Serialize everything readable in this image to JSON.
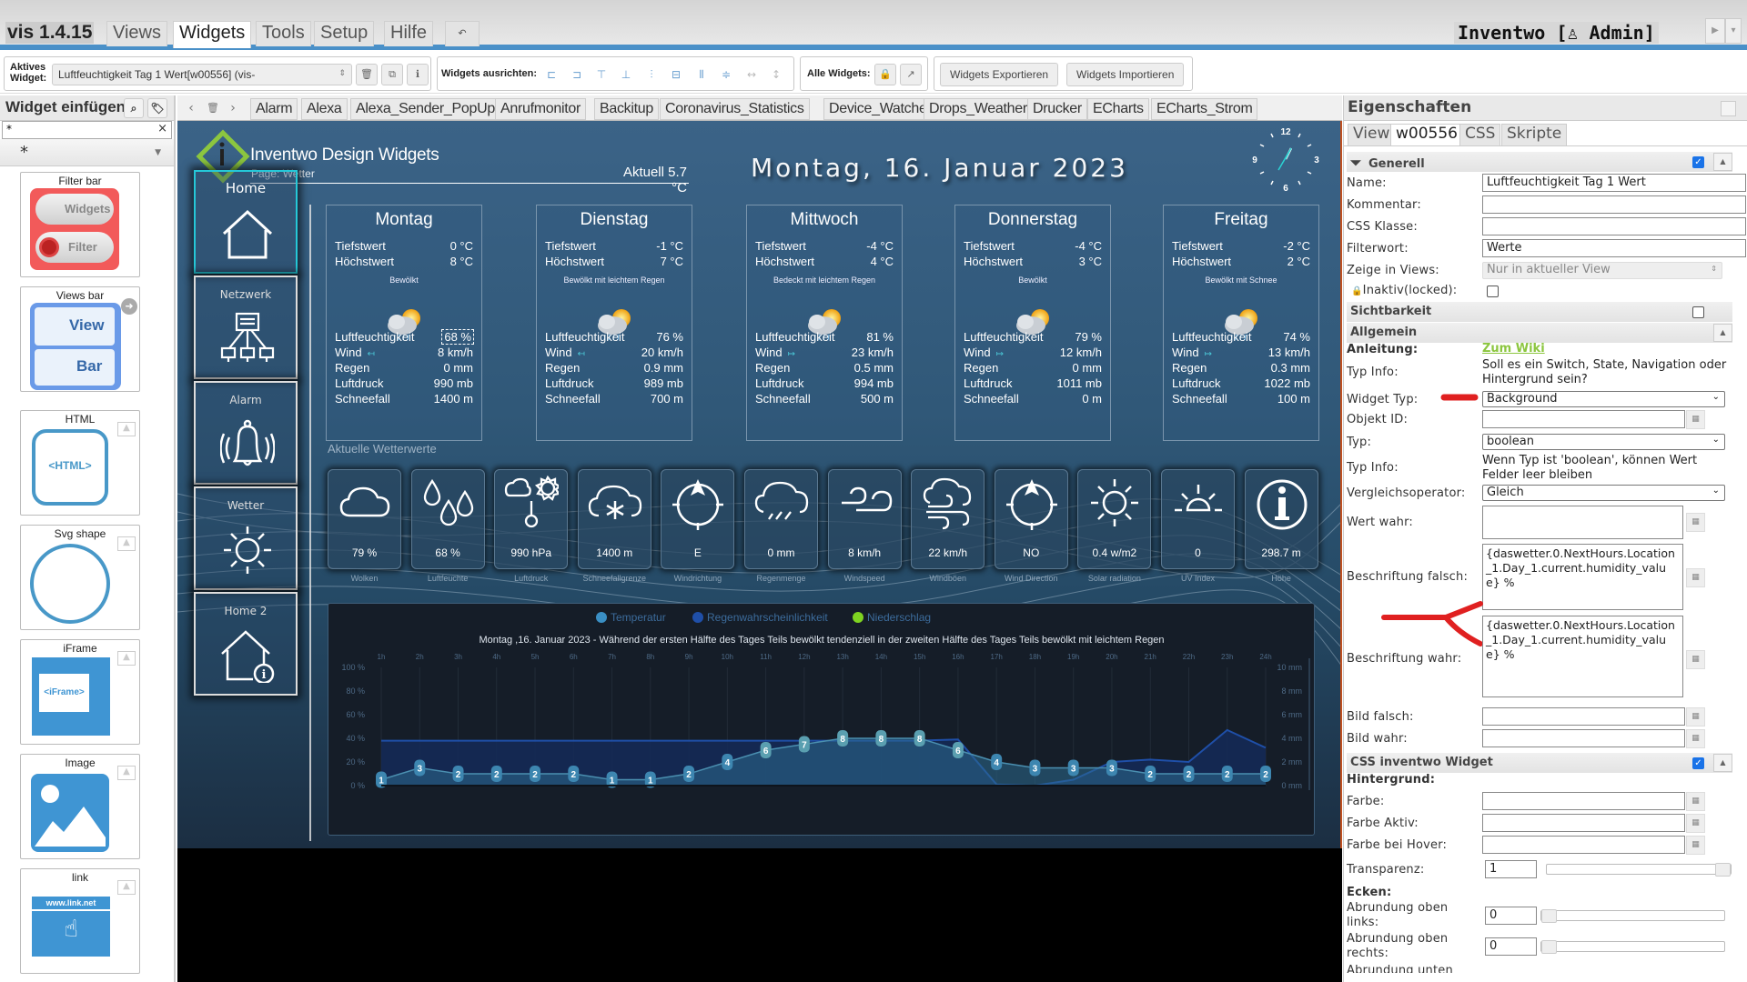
{
  "topbar": {
    "app_version": "vis 1.4.15",
    "menu": [
      "Views",
      "Widgets",
      "Tools",
      "Setup",
      "Hilfe"
    ],
    "active_menu": "Widgets",
    "undo_icon": "undo-icon",
    "project_user": "Inventwo [♙ Admin]"
  },
  "toolbar": {
    "active_widget_label": "Aktives Widget:",
    "active_widget_value": "Luftfeuchtigkeit Tag 1 Wert[w00556] (vis-",
    "align_label": "Widgets ausrichten:",
    "all_widgets_label": "Alle Widgets:",
    "export_label": "Widgets Exportieren",
    "import_label": "Widgets Importieren"
  },
  "palette": {
    "title": "Widget einfügen",
    "search_value": "*",
    "filter_value": "*",
    "cards": [
      {
        "title": "Filter bar",
        "btn1": "Widgets",
        "btn2": "Filter"
      },
      {
        "title": "Views bar",
        "btn1": "View",
        "btn2": "Bar"
      },
      {
        "title": "HTML",
        "label": "<HTML>"
      },
      {
        "title": "Svg shape"
      },
      {
        "title": "iFrame",
        "label": "<iFrame>"
      },
      {
        "title": "Image"
      },
      {
        "title": "link",
        "label": "www.link.net"
      }
    ]
  },
  "view_tabs": [
    "Alarm",
    "Alexa",
    "Alexa_Sender_PopUp",
    "Anrufmonitor",
    "Backitup",
    "Coronavirus_Statistics",
    "Device_Watcher",
    "Drops_Weather",
    "Drucker",
    "ECharts",
    "ECharts_Strom"
  ],
  "dashboard": {
    "title": "Inventwo Design Widgets",
    "page": "Page: Wetter",
    "current_temp": "Aktuell 5.7 °C",
    "date": "Montag, 16. Januar 2023",
    "clock": {
      "n12": "12",
      "n3": "3",
      "n6": "6",
      "n9": "9"
    },
    "nav": [
      {
        "label": "Home",
        "icon": "home-icon",
        "active": true
      },
      {
        "label": "Netzwerk",
        "icon": "network-icon"
      },
      {
        "label": "Alarm",
        "icon": "bell-icon"
      },
      {
        "label": "Wetter",
        "icon": "sun-icon"
      },
      {
        "label": "Home 2",
        "icon": "home-info-icon"
      }
    ],
    "row_labels": {
      "low": "Tiefstwert",
      "high": "Höchstwert",
      "hum": "Luftfeuchtigkeit",
      "wind": "Wind",
      "rain": "Regen",
      "pressure": "Luftdruck",
      "snow": "Schneefall"
    },
    "days": [
      {
        "name": "Montag",
        "low": "0 °C",
        "high": "8 °C",
        "desc": "Bewölkt",
        "hum": "68 %",
        "wind": "8 km/h",
        "wind_dir": "west",
        "rain": "0 mm",
        "pressure": "990 mb",
        "snow": "1400 m"
      },
      {
        "name": "Dienstag",
        "low": "-1 °C",
        "high": "7 °C",
        "desc": "Bewölkt mit leichtem Regen",
        "hum": "76 %",
        "wind": "20 km/h",
        "wind_dir": "west",
        "rain": "0.9 mm",
        "pressure": "989 mb",
        "snow": "700 m"
      },
      {
        "name": "Mittwoch",
        "low": "-4 °C",
        "high": "4 °C",
        "desc": "Bedeckt mit leichtem Regen",
        "hum": "81 %",
        "wind": "23 km/h",
        "wind_dir": "east",
        "rain": "0.5 mm",
        "pressure": "994 mb",
        "snow": "500 m"
      },
      {
        "name": "Donnerstag",
        "low": "-4 °C",
        "high": "3 °C",
        "desc": "Bewölkt",
        "hum": "79 %",
        "wind": "12 km/h",
        "wind_dir": "east",
        "rain": "0 mm",
        "pressure": "1011 mb",
        "snow": "0 m"
      },
      {
        "name": "Freitag",
        "low": "-2 °C",
        "high": "2 °C",
        "desc": "Bewölkt mit Schnee",
        "hum": "74 %",
        "wind": "13 km/h",
        "wind_dir": "east",
        "rain": "0.3 mm",
        "pressure": "1022 mb",
        "snow": "100 m"
      }
    ],
    "current_label": "Aktuelle Wetterwerte",
    "current": [
      {
        "value": "79 %",
        "label": "Wolken",
        "icon": "cloud-icon"
      },
      {
        "value": "68 %",
        "label": "Luftfeuchte",
        "icon": "droplets-icon"
      },
      {
        "value": "990 hPa",
        "label": "Luftdruck",
        "icon": "barometer-icon"
      },
      {
        "value": "1400 m",
        "label": "Schneefallgrenze",
        "icon": "snow-cloud-icon"
      },
      {
        "value": "E",
        "label": "Windrichtung",
        "icon": "compass-icon"
      },
      {
        "value": "0 mm",
        "label": "Regenmenge",
        "icon": "rain-cloud-icon"
      },
      {
        "value": "8 km/h",
        "label": "Windspeed",
        "icon": "wind-icon"
      },
      {
        "value": "22 km/h",
        "label": "Windböen",
        "icon": "wind-cloud-icon"
      },
      {
        "value": "NO",
        "label": "Wind Direction",
        "icon": "compass-icon"
      },
      {
        "value": "0.4 w/m2",
        "label": "Solar radiation",
        "icon": "sun-icon"
      },
      {
        "value": "0",
        "label": "UV Index",
        "icon": "sunrise-icon"
      },
      {
        "value": "298.7 m",
        "label": "Höhe",
        "icon": "info-icon"
      }
    ]
  },
  "chart_data": {
    "type": "line",
    "title": "Montag ,16. Januar 2023 - Während der ersten Hälfte des Tages Teils bewölkt tendenziell in der zweiten Hälfte des Tages Teils bewölkt mit leichtem Regen",
    "legend": [
      {
        "name": "Temperatur",
        "color": "#3a8fc4"
      },
      {
        "name": "Regenwahrscheinlichkeit",
        "color": "#1f4fa8"
      },
      {
        "name": "Niederschlag",
        "color": "#7ed321"
      }
    ],
    "legend_position": "top-center",
    "categories": [
      "1h",
      "2h",
      "3h",
      "4h",
      "5h",
      "6h",
      "7h",
      "8h",
      "9h",
      "10h",
      "11h",
      "12h",
      "13h",
      "14h",
      "15h",
      "16h",
      "17h",
      "18h",
      "19h",
      "20h",
      "21h",
      "22h",
      "23h",
      "24h"
    ],
    "y_left": {
      "ticks": [
        "0 %",
        "20 %",
        "40 %",
        "60 %",
        "80 %",
        "100 %"
      ],
      "range": [
        0,
        100
      ]
    },
    "y_right": {
      "ticks": [
        "0 mm",
        "2 mm",
        "4 mm",
        "6 mm",
        "8 mm",
        "10 mm"
      ],
      "range": [
        0,
        10
      ]
    },
    "series": [
      {
        "name": "Temperatur",
        "values": [
          1,
          3,
          2,
          2,
          2,
          2,
          1,
          1,
          2,
          4,
          6,
          7,
          8,
          8,
          8,
          6,
          4,
          3,
          3,
          3,
          2,
          2,
          2,
          2
        ],
        "scale_max": 20
      },
      {
        "name": "Regenwahrscheinlichkeit",
        "values": [
          38,
          38,
          38,
          38,
          38,
          38,
          38,
          38,
          38,
          38,
          38,
          38,
          38,
          38,
          38,
          39,
          1,
          0,
          5,
          20,
          22,
          20,
          47,
          32
        ],
        "unit": "%"
      }
    ]
  },
  "props": {
    "title": "Eigenschaften",
    "tabs": [
      "View",
      "w00556",
      "CSS",
      "Skripte"
    ],
    "active_tab": "w00556",
    "group_generell": "Generell",
    "name_label": "Name:",
    "name_value": "Luftfeuchtigkeit Tag 1 Wert",
    "comment_label": "Kommentar:",
    "comment_value": "",
    "css_class_label": "CSS Klasse:",
    "css_class_value": "",
    "filter_label": "Filterwort:",
    "filter_value": "Werte",
    "views_label": "Zeige in Views:",
    "views_value": "Nur in aktueller View",
    "locked_label": "Inaktiv(locked):",
    "group_visibility": "Sichtbarkeit",
    "group_general": "Allgemein",
    "guide_label": "Anleitung:",
    "guide_link": "Zum Wiki",
    "typeinfo_label": "Typ Info:",
    "typeinfo_text": "Soll es ein Switch, State, Navigation oder Hintergrund sein?",
    "widget_type_label": "Widget Typ:",
    "widget_type_value": "Background",
    "object_id_label": "Objekt ID:",
    "object_id_value": "",
    "type_label": "Typ:",
    "type_value": "boolean",
    "typeinfo2_label": "Typ Info:",
    "typeinfo2_text": "Wenn Typ ist 'boolean', können Wert Felder leer bleiben",
    "operator_label": "Vergleichsoperator:",
    "operator_value": "Gleich",
    "value_true_label": "Wert wahr:",
    "value_true_value": "",
    "caption_false_label": "Beschriftung falsch:",
    "caption_false_value": "{daswetter.0.NextHours.Location_1.Day_1.current.humidity_value} %",
    "caption_true_label": "Beschriftung wahr:",
    "caption_true_value": "{daswetter.0.NextHours.Location_1.Day_1.current.humidity_value} %",
    "img_false_label": "Bild falsch:",
    "img_true_label": "Bild wahr:",
    "group_css": "CSS inventwo Widget",
    "bg_label": "Hintergrund:",
    "color_label": "Farbe:",
    "color_active_label": "Farbe Aktiv:",
    "color_hover_label": "Farbe bei Hover:",
    "transparency_label": "Transparenz:",
    "transparency_value": "1",
    "corners_label": "Ecken:",
    "radius_tl_label": "Abrundung oben links:",
    "radius_tl_value": "0",
    "radius_tr_label": "Abrundung oben rechts:",
    "radius_tr_value": "0",
    "radius_bl_label": "Abrundung unten"
  }
}
